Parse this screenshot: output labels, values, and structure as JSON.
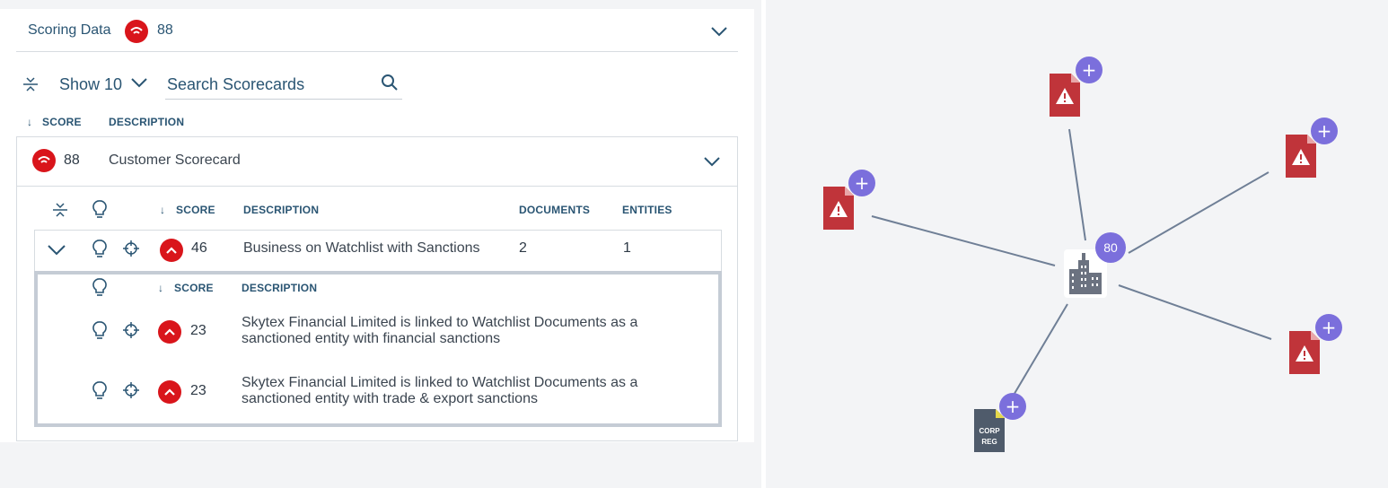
{
  "scoring": {
    "title": "Scoring Data",
    "score": "88"
  },
  "toolbar": {
    "show_label": "Show 10",
    "search_placeholder": "Search Scorecards"
  },
  "table": {
    "col_score": "SCORE",
    "col_description": "DESCRIPTION",
    "sort_arrow": "↓"
  },
  "scorecard": {
    "score": "88",
    "name": "Customer Scorecard"
  },
  "rules_table": {
    "col_score": "SCORE",
    "col_description": "DESCRIPTION",
    "col_documents": "DOCUMENTS",
    "col_entities": "ENTITIES"
  },
  "rule": {
    "score": "46",
    "description": "Business on Watchlist with Sanctions",
    "documents": "2",
    "entities": "1"
  },
  "details": {
    "col_score": "SCORE",
    "col_description": "DESCRIPTION",
    "items": [
      {
        "score": "23",
        "line1": "Skytex Financial Limited is linked to Watchlist Documents as a",
        "line2": "sanctioned entity with financial sanctions"
      },
      {
        "score": "23",
        "line1": "Skytex Financial Limited is linked to Watchlist Documents as a",
        "line2": "sanctioned entity with trade & export sanctions"
      }
    ]
  },
  "graph": {
    "center_score": "80",
    "plus": "+",
    "corp_line1": "CORP",
    "corp_line2": "REG",
    "colors": {
      "watchlist_doc": "#c0343a",
      "corp_doc": "#4f5b6b",
      "badge": "#7b6fdc",
      "edge": "#6f7f96"
    }
  }
}
